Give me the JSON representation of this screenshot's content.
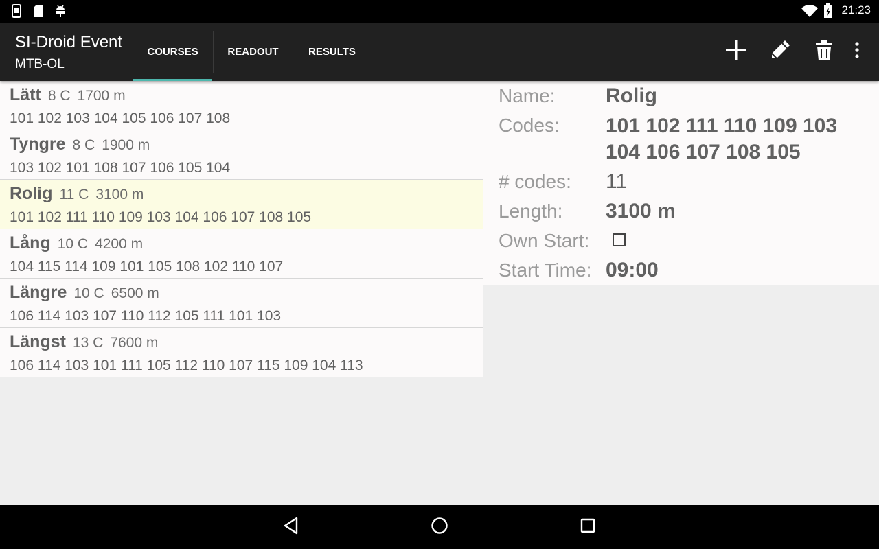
{
  "status_bar": {
    "time": "21:23",
    "left_icons": [
      "phone-notification-icon",
      "sd-card-icon",
      "android-debug-icon"
    ],
    "right_icons": [
      "wifi-icon",
      "battery-charging-icon"
    ]
  },
  "action_bar": {
    "title": "SI-Droid Event",
    "subtitle": "MTB-OL",
    "tabs": [
      {
        "label": "COURSES",
        "active": true
      },
      {
        "label": "READOUT",
        "active": false
      },
      {
        "label": "RESULTS",
        "active": false
      }
    ],
    "actions": [
      "add-icon",
      "edit-icon",
      "delete-icon",
      "overflow-menu-icon"
    ]
  },
  "courses": [
    {
      "name": "Lätt",
      "controls": "8 C",
      "length": "1700 m",
      "codes": "101 102 103 104 105 106 107 108",
      "selected": false
    },
    {
      "name": "Tyngre",
      "controls": "8 C",
      "length": "1900 m",
      "codes": "103 102 101 108 107 106 105 104",
      "selected": false
    },
    {
      "name": "Rolig",
      "controls": "11 C",
      "length": "3100 m",
      "codes": "101 102 111 110 109 103 104 106 107 108 105",
      "selected": true
    },
    {
      "name": "Lång",
      "controls": "10 C",
      "length": "4200 m",
      "codes": "104 115 114 109 101 105 108 102 110 107",
      "selected": false
    },
    {
      "name": "Längre",
      "controls": "10 C",
      "length": "6500 m",
      "codes": "106 114 103 107 110 112 105 111 101 103",
      "selected": false
    },
    {
      "name": "Längst",
      "controls": "13 C",
      "length": "7600 m",
      "codes": "106 114 103 101 111 105 112 110 107 115 109 104 113",
      "selected": false
    }
  ],
  "detail": {
    "name_label": "Name:",
    "name_value": "Rolig",
    "codes_label": "Codes:",
    "codes_value": "101 102 111 110 109 103 104 106 107 108 105",
    "num_codes_label": "# codes:",
    "num_codes_value": "11",
    "length_label": "Length:",
    "length_value": "3100 m",
    "own_start_label": "Own Start:",
    "own_start_checked": false,
    "start_time_label": "Start Time:",
    "start_time_value": "09:00"
  },
  "nav_bar": [
    "back-icon",
    "home-icon",
    "recents-icon"
  ]
}
